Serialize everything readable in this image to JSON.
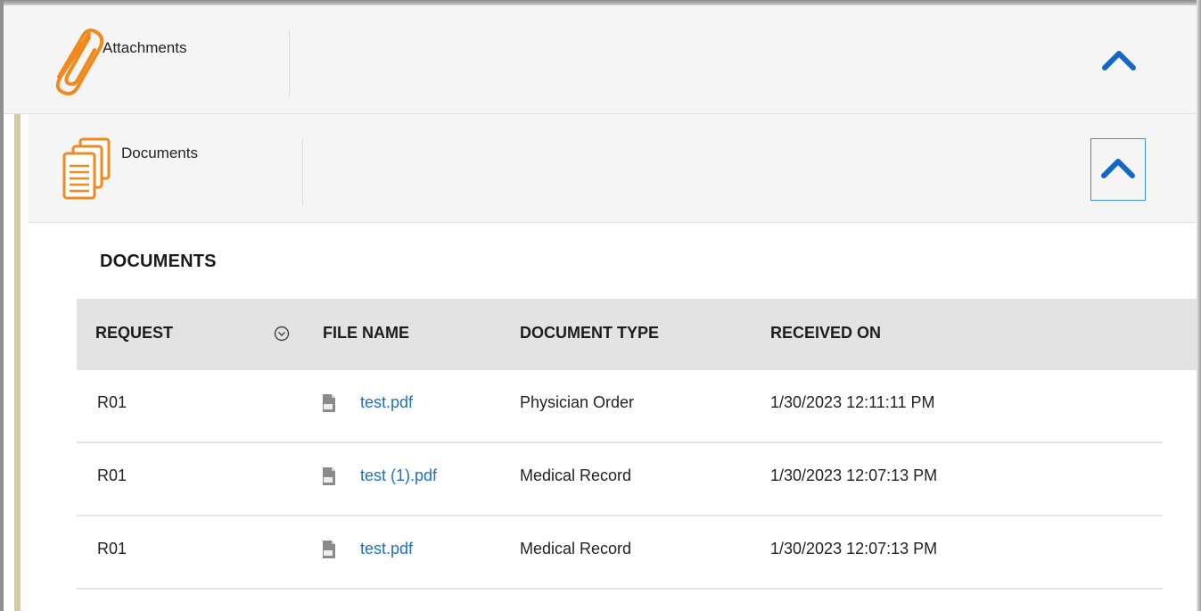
{
  "attachments": {
    "title": "Attachments",
    "icon": "paperclip-icon",
    "collapse_icon": "chevron-up-icon",
    "accent_color": "#f08a1e",
    "chevron_color": "#1267c9"
  },
  "documents_panel": {
    "title": "Documents",
    "icon": "documents-stack-icon",
    "collapse_icon": "chevron-up-icon"
  },
  "documents_section": {
    "heading": "DOCUMENTS",
    "columns": {
      "request": "REQUEST",
      "file_name": "FILE NAME",
      "document_type": "DOCUMENT TYPE",
      "received_on": "RECEIVED ON"
    },
    "rows": [
      {
        "request": "R01",
        "file_name": "test.pdf",
        "document_type": "Physician Order",
        "received_on": "1/30/2023 12:11:11 PM"
      },
      {
        "request": "R01",
        "file_name": "test (1).pdf",
        "document_type": "Medical Record",
        "received_on": "1/30/2023 12:07:13 PM"
      },
      {
        "request": "R01",
        "file_name": "test.pdf",
        "document_type": "Medical Record",
        "received_on": "1/30/2023 12:07:13 PM"
      }
    ],
    "link_color": "#1f6fc4"
  }
}
